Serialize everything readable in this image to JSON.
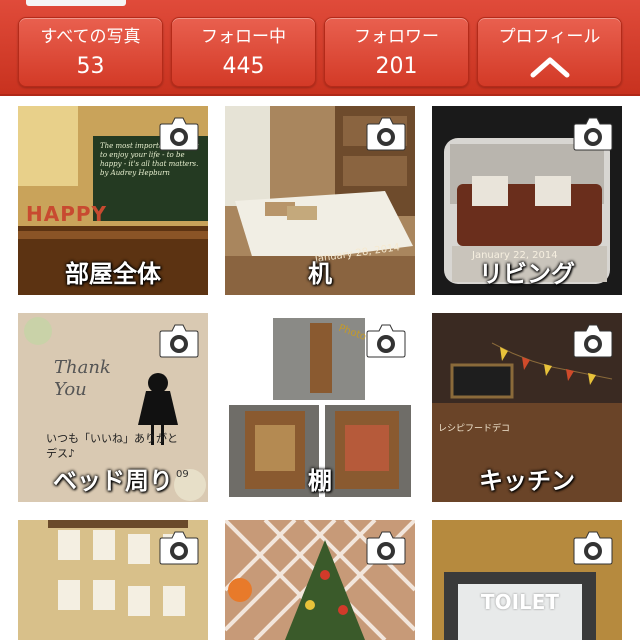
{
  "header": {
    "stats": [
      {
        "label": "すべての写真",
        "count": "53"
      },
      {
        "label": "フォロー中",
        "count": "445"
      },
      {
        "label": "フォロワー",
        "count": "201"
      }
    ],
    "profile": {
      "label": "プロフィール",
      "icon": "chevron-up-icon"
    }
  },
  "photos": [
    {
      "caption": "部屋全体",
      "scene": "chalkboard-room",
      "text": "The most important thing is to enjoy your life - to be happy - it's all that matters. by Audrey Hepburn",
      "letters": "HAPPY"
    },
    {
      "caption": "机",
      "scene": "white-table",
      "text": "January 28, 2014"
    },
    {
      "caption": "リビング",
      "scene": "leather-sofa",
      "text": "January 22, 2014"
    },
    {
      "caption": "ベッド周り",
      "scene": "thank-you-card",
      "text": "Thank You",
      "text2": "いつも「いいね」ありがとデス♪",
      "text3": "09"
    },
    {
      "caption": "棚",
      "scene": "wood-frames",
      "text": "Photo frame"
    },
    {
      "caption": "キッチン",
      "scene": "kitchen-bunting",
      "text": "レシピフードデコ"
    },
    {
      "caption": "",
      "scene": "wall-pockets"
    },
    {
      "caption": "",
      "scene": "christmas-tree"
    },
    {
      "caption": "",
      "scene": "toilet-sign",
      "text": "TOILET"
    }
  ],
  "colors": {
    "header_red": "#d33a27",
    "header_text": "#ffffff"
  }
}
